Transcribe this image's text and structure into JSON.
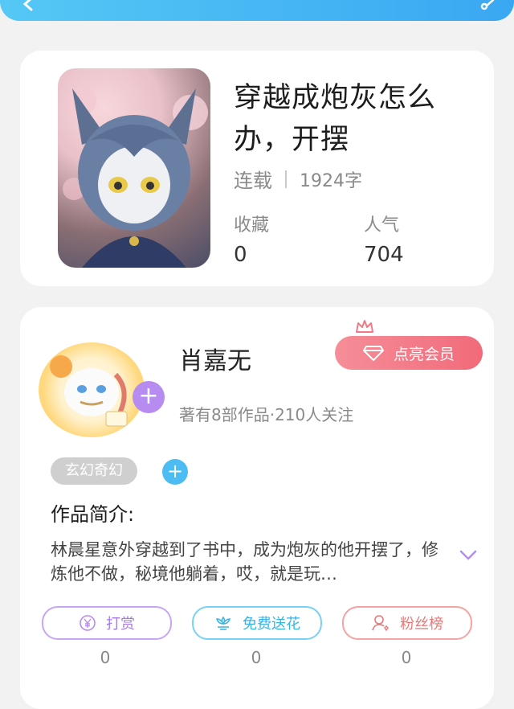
{
  "book": {
    "title": "穿越成炮灰怎么办，开摆",
    "status": "连载",
    "word_count": "1924字",
    "stats": [
      {
        "label": "收藏",
        "value": "0"
      },
      {
        "label": "人气",
        "value": "704"
      }
    ]
  },
  "author": {
    "name": "肖嘉无",
    "vip_button": "点亮会员",
    "stats_text": "著有8部作品·210人关注"
  },
  "genre_tag": "玄幻奇幻",
  "synopsis": {
    "title": "作品简介:",
    "text": "林晨星意外穿越到了书中，成为炮灰的他开摆了，修炼他不做，秘境他躺着，哎，就是玩…"
  },
  "actions": [
    {
      "label": "打赏",
      "count": "0",
      "color": "#b68cf0",
      "icon": "yen-coin-icon"
    },
    {
      "label": "免费送花",
      "count": "0",
      "color": "#56c8f0",
      "icon": "flower-icon"
    },
    {
      "label": "粉丝榜",
      "count": "0",
      "color": "#f08a8a",
      "icon": "fan-user-icon"
    }
  ]
}
